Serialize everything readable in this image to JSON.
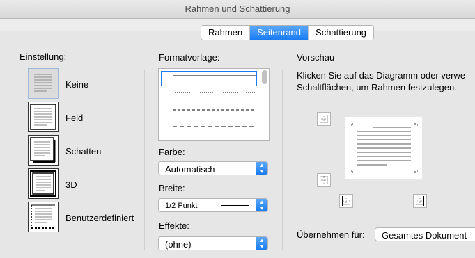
{
  "window": {
    "title": "Rahmen und Schattierung"
  },
  "tabs": [
    {
      "label": "Rahmen"
    },
    {
      "label": "Seitenrand"
    },
    {
      "label": "Schattierung"
    }
  ],
  "settings": {
    "heading": "Einstellung:",
    "items": [
      {
        "label": "Keine"
      },
      {
        "label": "Feld"
      },
      {
        "label": "Schatten"
      },
      {
        "label": "3D"
      },
      {
        "label": "Benutzerdefiniert"
      }
    ]
  },
  "format": {
    "heading": "Formatvorlage:",
    "color_label": "Farbe:",
    "color_value": "Automatisch",
    "width_label": "Breite:",
    "width_value": "1/2 Punkt",
    "effects_label": "Effekte:",
    "effects_value": "(ohne)"
  },
  "preview": {
    "heading": "Vorschau",
    "hint_line1": "Klicken Sie auf das Diagramm oder verwe",
    "hint_line2": "Schaltflächen, um Rahmen festzulegen.",
    "apply_label": "Übernehmen für:",
    "apply_value": "Gesamtes Dokument"
  },
  "colors": {
    "accent": "#1a7cf3"
  }
}
